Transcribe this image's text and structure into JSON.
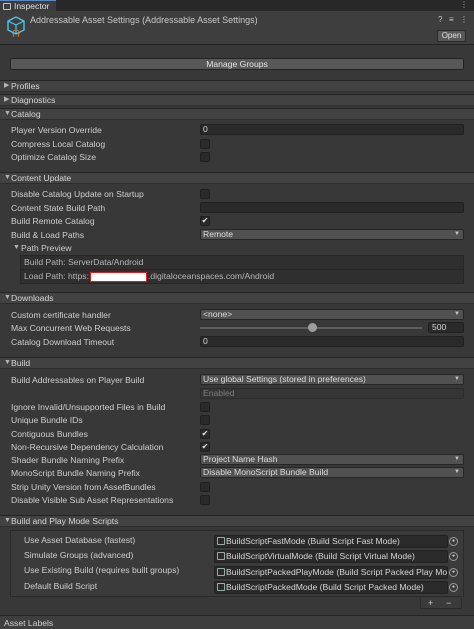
{
  "tab": {
    "label": "Inspector"
  },
  "header": {
    "title": "Addressable Asset Settings (Addressable Asset Settings)",
    "open_label": "Open",
    "icons": [
      "help-icon",
      "settings-sliders-icon",
      "more-icon"
    ]
  },
  "manage_groups_label": "Manage Groups",
  "sections": {
    "profiles": "Profiles",
    "diagnostics": "Diagnostics",
    "catalog": "Catalog",
    "content_update": "Content Update",
    "downloads": "Downloads",
    "build": "Build",
    "build_play_scripts": "Build and Play Mode Scripts",
    "asset_labels": "Asset Labels"
  },
  "catalog": {
    "player_version_override": {
      "label": "Player Version Override",
      "value": "0"
    },
    "compress_local_catalog": {
      "label": "Compress Local Catalog",
      "checked": false
    },
    "optimize_catalog_size": {
      "label": "Optimize Catalog Size",
      "checked": false
    }
  },
  "content_update": {
    "disable_catalog_update": {
      "label": "Disable Catalog Update on Startup",
      "checked": false
    },
    "content_state_build_path": {
      "label": "Content State Build Path",
      "value": ""
    },
    "build_remote_catalog": {
      "label": "Build Remote Catalog",
      "checked": true
    },
    "build_load_paths": {
      "label": "Build & Load Paths",
      "value": "Remote"
    },
    "path_preview": {
      "label": "Path Preview",
      "build_path": "Build Path: ServerData/Android",
      "load_path_prefix": "Load Path: https:",
      "load_path_suffix": ".digitaloceanspaces.com/Android"
    }
  },
  "downloads": {
    "custom_cert_handler": {
      "label": "Custom certificate handler",
      "value": "<none>"
    },
    "max_concurrent": {
      "label": "Max Concurrent Web Requests",
      "value": "500",
      "fraction": 0.5
    },
    "catalog_timeout": {
      "label": "Catalog Download Timeout",
      "value": "0"
    }
  },
  "build": {
    "build_on_player_build": {
      "label": "Build Addressables on Player Build",
      "value": "Use global Settings (stored in preferences)",
      "sub_value": "Enabled"
    },
    "ignore_invalid": {
      "label": "Ignore Invalid/Unsupported Files in Build",
      "checked": false
    },
    "unique_bundle_ids": {
      "label": "Unique Bundle IDs",
      "checked": false
    },
    "contiguous_bundles": {
      "label": "Contiguous Bundles",
      "checked": true
    },
    "non_recursive": {
      "label": "Non-Recursive Dependency Calculation",
      "checked": true
    },
    "shader_naming": {
      "label": "Shader Bundle Naming Prefix",
      "value": "Project Name Hash"
    },
    "monoscript_naming": {
      "label": "MonoScript Bundle Naming Prefix",
      "value": "Disable MonoScript Bundle Build"
    },
    "strip_unity_version": {
      "label": "Strip Unity Version from AssetBundles",
      "checked": false
    },
    "disable_visible_sub": {
      "label": "Disable Visible Sub Asset Representations",
      "checked": false
    }
  },
  "scripts": [
    {
      "label": "Use Asset Database (fastest)",
      "value": "BuildScriptFastMode (Build Script Fast Mode)"
    },
    {
      "label": "Simulate Groups (advanced)",
      "value": "BuildScriptVirtualMode (Build Script Virtual Mode)"
    },
    {
      "label": "Use Existing Build (requires built groups)",
      "value": "BuildScriptPackedPlayMode (Build Script Packed Play Mode)"
    },
    {
      "label": "Default Build Script",
      "value": "BuildScriptPackedMode (Build Script Packed Mode)"
    }
  ],
  "list_controls": {
    "add": "+",
    "remove": "−"
  }
}
